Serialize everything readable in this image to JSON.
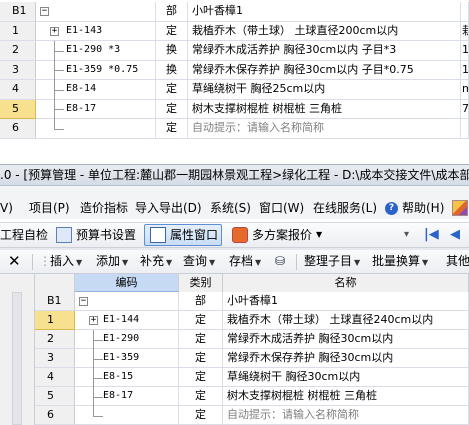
{
  "top_grid": {
    "rows": [
      {
        "rownum": "B1",
        "code": "",
        "type": "部",
        "name": "小叶香樟1",
        "extra": "",
        "tree": "minus"
      },
      {
        "rownum": "1",
        "code": "E1-143",
        "type": "定",
        "name": "栽植乔木（带土球） 土球直径200cm以内",
        "extra": "栽",
        "tree": "plus"
      },
      {
        "rownum": "2",
        "code": "E1-290 *3",
        "type": "换",
        "name": "常绿乔木成活养护 胸径30cm以内 子目*3",
        "extra": "1",
        "tree": "line"
      },
      {
        "rownum": "3",
        "code": "E1-359 *0.75",
        "type": "换",
        "name": "常绿乔木保存养护 胸径30cm以内 子目*0.75",
        "extra": "1",
        "tree": "line"
      },
      {
        "rownum": "4",
        "code": "E8-14",
        "type": "定",
        "name": "草绳绕树干 胸径25cm以内",
        "extra": "m",
        "tree": "line"
      },
      {
        "rownum": "5",
        "code": "E8-17",
        "type": "定",
        "name": "树木支撑树棍桩 树棍桩 三角桩",
        "extra": "7",
        "tree": "line"
      },
      {
        "rownum": "6",
        "code": "",
        "type": "定",
        "name": "自动提示：请输入名称简称",
        "extra": "",
        "tree": "end"
      }
    ]
  },
  "titlebar": {
    "text": ".0 - [预算管理 - 单位工程:麓山郡一期园林景观工程>绿化工程 - D:\\成本交接文件\\成本部"
  },
  "menu": {
    "items": [
      "V)",
      "项目(P)",
      "造价指标",
      "导入导出(D)",
      "系统(S)",
      "窗口(W)",
      "在线服务(L)",
      "帮助(H)"
    ]
  },
  "toolbar1": {
    "self_check": "工程自检",
    "budget_settings": "预算书设置",
    "property_window": "属性窗口",
    "multi_scheme": "多方案报价"
  },
  "toolbar2": {
    "insert": "插入",
    "add": "添加",
    "supplement": "补充",
    "query": "查询",
    "archive": "存档",
    "organize": "整理子目",
    "batch": "批量换算",
    "other": "其他"
  },
  "bottom_grid": {
    "headers": {
      "code": "编码",
      "type": "类别",
      "name": "名称"
    },
    "rows": [
      {
        "rownum": "B1",
        "code": "",
        "type": "部",
        "name": "小叶香樟1",
        "tree": "minus"
      },
      {
        "rownum": "1",
        "code": "E1-144",
        "type": "定",
        "name": "栽植乔木（带土球） 土球直径240cm以内",
        "tree": "plus"
      },
      {
        "rownum": "2",
        "code": "E1-290",
        "type": "定",
        "name": "常绿乔木成活养护 胸径30cm以内",
        "tree": "line"
      },
      {
        "rownum": "3",
        "code": "E1-359",
        "type": "定",
        "name": "常绿乔木保存养护 胸径30cm以内",
        "tree": "line"
      },
      {
        "rownum": "4",
        "code": "E8-15",
        "type": "定",
        "name": "草绳绕树干 胸径30cm以内",
        "tree": "line"
      },
      {
        "rownum": "5",
        "code": "E8-17",
        "type": "定",
        "name": "树木支撑树棍桩 树棍桩 三角桩",
        "tree": "line"
      },
      {
        "rownum": "6",
        "code": "",
        "type": "定",
        "name": "自动提示：请输入名称简称",
        "tree": "end"
      }
    ]
  },
  "colors": {
    "highlight": "#f7e08e",
    "accent": "#2a63c9"
  }
}
